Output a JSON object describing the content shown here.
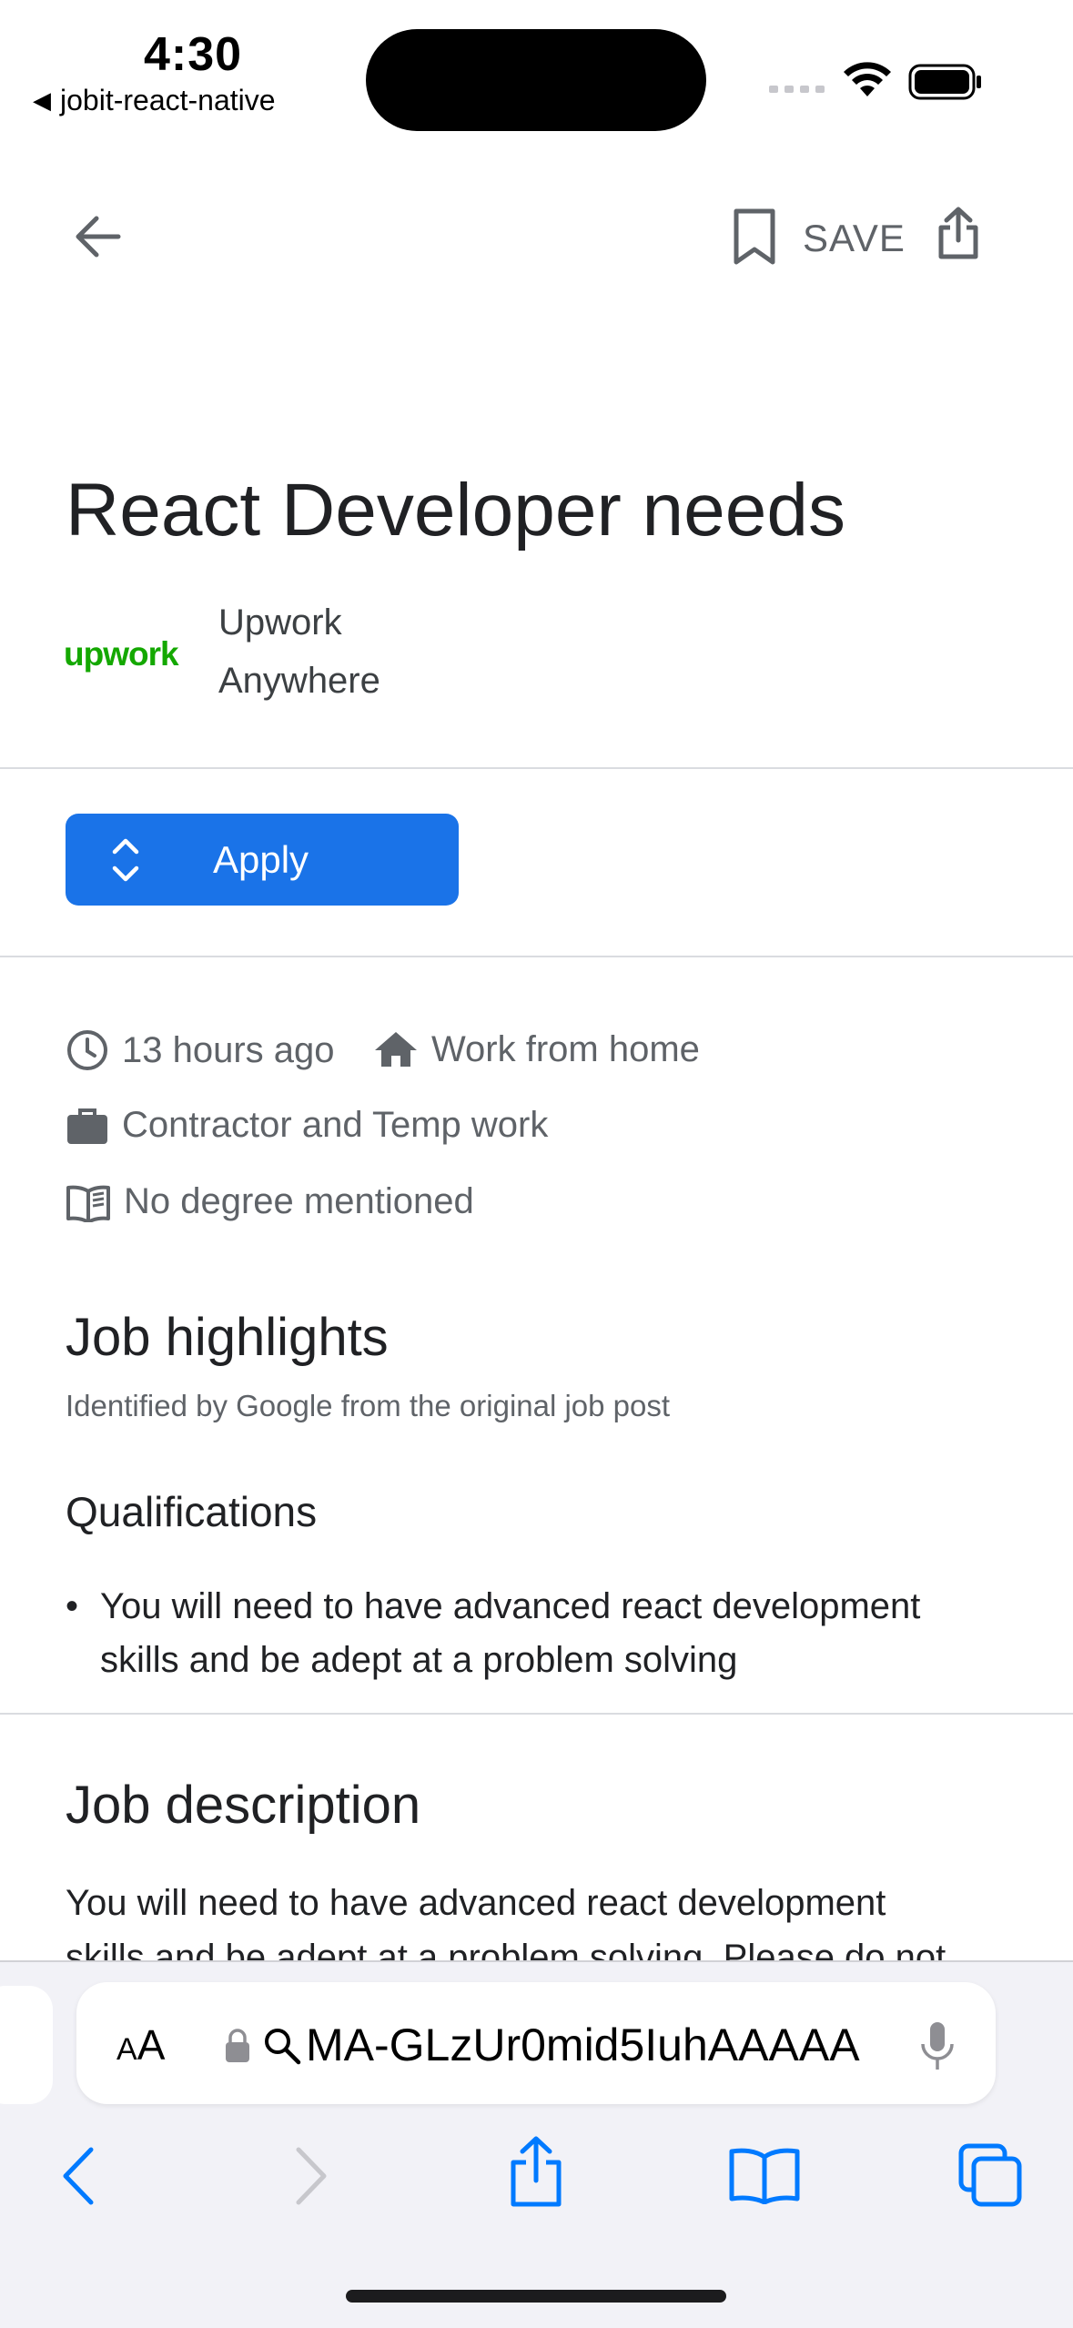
{
  "status_bar": {
    "time": "4:30",
    "back_app": "jobit-react-native"
  },
  "toolbar": {
    "save_label": "SAVE"
  },
  "job": {
    "title": "React Developer needs",
    "logo_text": "upwork",
    "company": "Upwork",
    "location": "Anywhere",
    "apply_label": "Apply",
    "posted": "13 hours ago",
    "work_mode": "Work from home",
    "employment_type": "Contractor and Temp work",
    "degree": "No degree mentioned"
  },
  "highlights": {
    "heading": "Job highlights",
    "subheading": "Identified by Google from the original job post",
    "qualifications_heading": "Qualifications",
    "qualifications": [
      "You will need to have advanced react development skills and be adept at a problem solving"
    ]
  },
  "description": {
    "heading": "Job description",
    "line1": "You will need to have advanced react development",
    "line2": "skills and be adept at a problem solving. Please do not"
  },
  "browser": {
    "aa_label_small": "A",
    "aa_label_large": "A",
    "url": "MA-GLzUr0mid5IuhAAAAA"
  },
  "colors": {
    "accent": "#1a73e8",
    "upwork_green": "#14a800",
    "ios_blue": "#007aff"
  }
}
